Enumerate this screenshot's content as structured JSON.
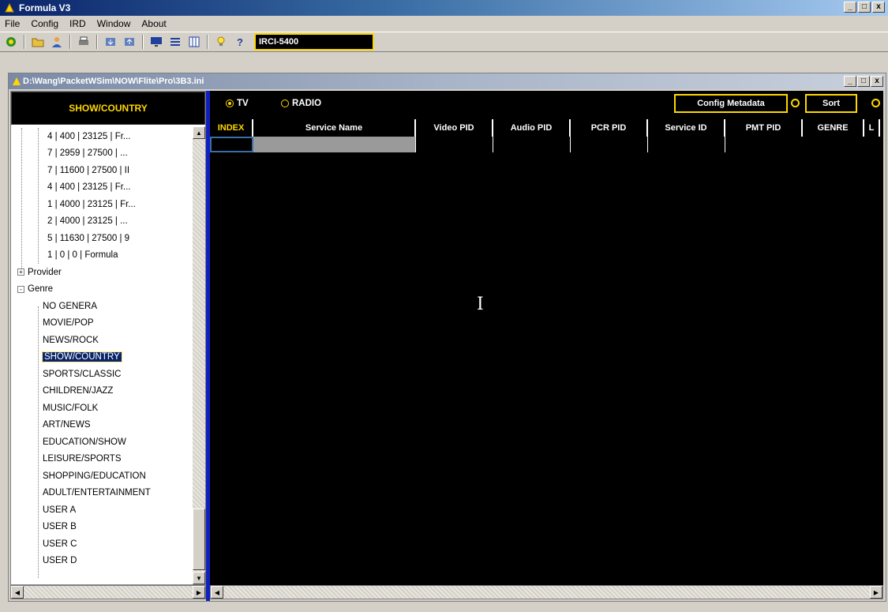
{
  "app": {
    "title": "Formula V3",
    "window_buttons": [
      "_",
      "□",
      "x"
    ]
  },
  "menu": [
    "File",
    "Config",
    "IRD",
    "Window",
    "About"
  ],
  "toolbar": {
    "icons": [
      "connect-icon",
      "open-folder-icon",
      "user-icon",
      "print-icon",
      "download-icon",
      "upload-icon",
      "monitor-icon",
      "list-icon",
      "columns-icon",
      "lightbulb-icon",
      "help-icon"
    ],
    "device": "IRCI-5400"
  },
  "child": {
    "title": "D:\\Wang\\PacketWSim\\NOW\\Flite\\Pro\\3B3.ini"
  },
  "left": {
    "header": "SHOW/COUNTRY",
    "tree": [
      {
        "label": "4 | 400 | 23125 | Fr...",
        "level": 2
      },
      {
        "label": "7 | 2959 | 27500 | ...",
        "level": 2
      },
      {
        "label": "7 | 11600 | 27500 | II",
        "level": 2
      },
      {
        "label": "4 | 400 | 23125 | Fr...",
        "level": 2
      },
      {
        "label": "1 | 4000 | 23125 | Fr...",
        "level": 2
      },
      {
        "label": "2 | 4000 | 23125 | ...",
        "level": 2
      },
      {
        "label": "5 | 11630 | 27500 | 9",
        "level": 2
      },
      {
        "label": "1 | 0 | 0 | Formula",
        "level": 2
      },
      {
        "label": "Provider",
        "level": 0,
        "expander": "+"
      },
      {
        "label": "Genre",
        "level": 0,
        "expander": "-"
      },
      {
        "label": "NO GENERA",
        "level": 1
      },
      {
        "label": "MOVIE/POP",
        "level": 1
      },
      {
        "label": "NEWS/ROCK",
        "level": 1
      },
      {
        "label": "SHOW/COUNTRY",
        "level": 1,
        "selected": true
      },
      {
        "label": "SPORTS/CLASSIC",
        "level": 1
      },
      {
        "label": "CHILDREN/JAZZ",
        "level": 1
      },
      {
        "label": "MUSIC/FOLK",
        "level": 1
      },
      {
        "label": "ART/NEWS",
        "level": 1
      },
      {
        "label": "EDUCATION/SHOW",
        "level": 1
      },
      {
        "label": "LEISURE/SPORTS",
        "level": 1
      },
      {
        "label": "SHOPPING/EDUCATION",
        "level": 1
      },
      {
        "label": "ADULT/ENTERTAINMENT",
        "level": 1
      },
      {
        "label": "USER A",
        "level": 1
      },
      {
        "label": "USER B",
        "level": 1
      },
      {
        "label": "USER C",
        "level": 1
      },
      {
        "label": "USER D",
        "level": 1
      }
    ]
  },
  "right": {
    "radio_tv": "TV",
    "radio_radio": "RADIO",
    "config_button": "Config Metadata",
    "sort_button": "Sort",
    "columns": [
      "INDEX",
      "Service Name",
      "Video PID",
      "Audio PID",
      "PCR PID",
      "Service ID",
      "PMT PID",
      "GENRE",
      "L"
    ]
  }
}
